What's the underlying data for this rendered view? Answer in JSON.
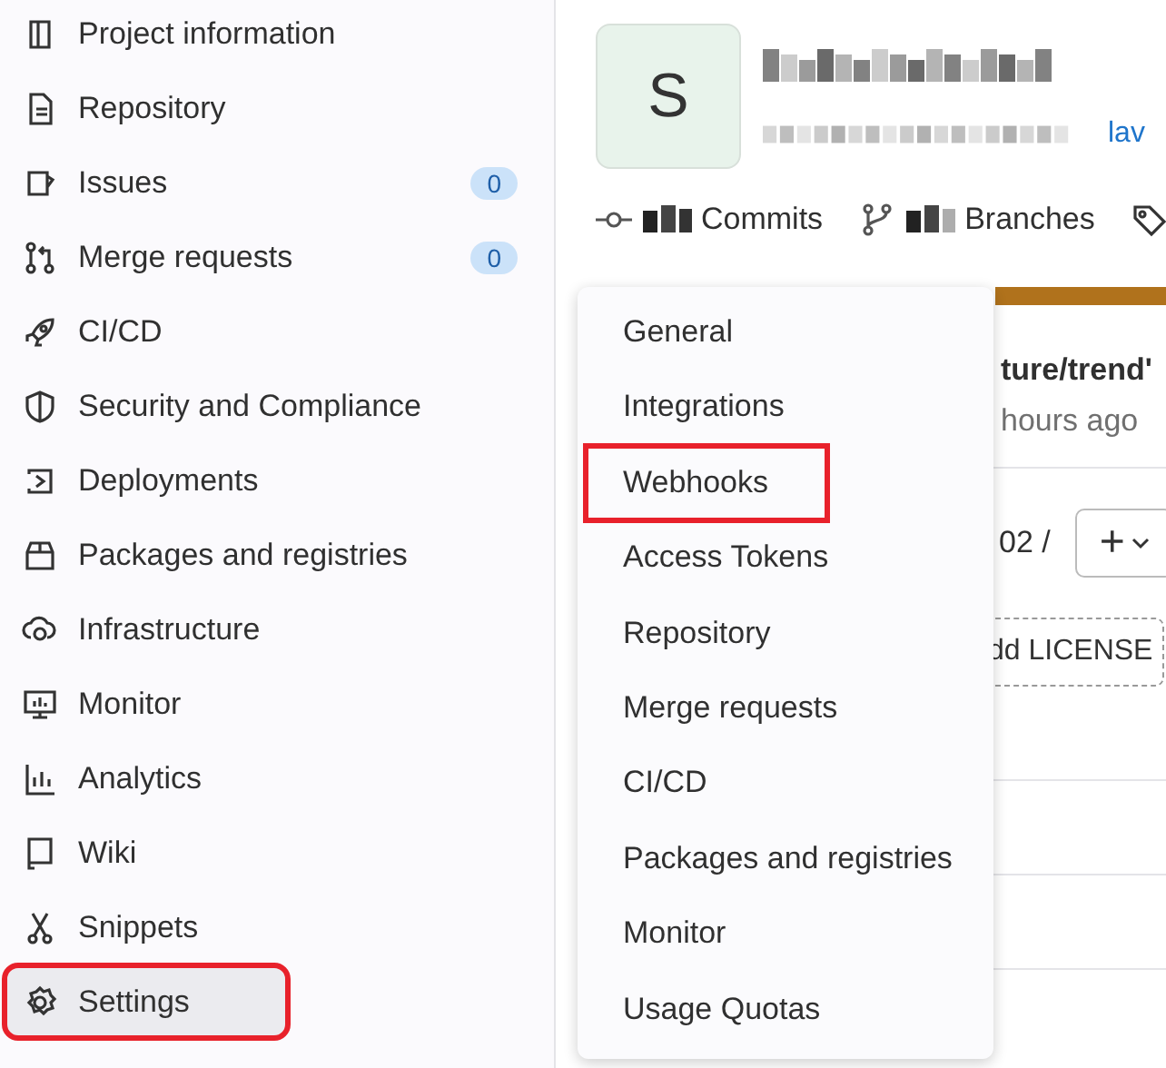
{
  "sidebar": {
    "items": [
      {
        "label": "Project information",
        "selected": false,
        "annotated": false
      },
      {
        "label": "Repository",
        "selected": false,
        "annotated": false
      },
      {
        "label": "Issues",
        "badge": "0",
        "selected": false,
        "annotated": false
      },
      {
        "label": "Merge requests",
        "badge": "0",
        "selected": false,
        "annotated": false
      },
      {
        "label": "CI/CD",
        "selected": false,
        "annotated": false
      },
      {
        "label": "Security and Compliance",
        "selected": false,
        "annotated": false
      },
      {
        "label": "Deployments",
        "selected": false,
        "annotated": false
      },
      {
        "label": "Packages and registries",
        "selected": false,
        "annotated": false
      },
      {
        "label": "Infrastructure",
        "selected": false,
        "annotated": false
      },
      {
        "label": "Monitor",
        "selected": false,
        "annotated": false
      },
      {
        "label": "Analytics",
        "selected": false,
        "annotated": false
      },
      {
        "label": "Wiki",
        "selected": false,
        "annotated": false
      },
      {
        "label": "Snippets",
        "selected": false,
        "annotated": false
      },
      {
        "label": "Settings",
        "selected": true,
        "annotated": true
      }
    ]
  },
  "project": {
    "avatar": "S",
    "link": "lav",
    "stats": [
      {
        "label": "Commits"
      },
      {
        "label": "Branches"
      }
    ]
  },
  "activity": {
    "branch": "ture/trend'",
    "time": "hours ago",
    "path": "02 /",
    "add_button": "+",
    "license_button": "dd LICENSE"
  },
  "settings_menu": {
    "items": [
      {
        "label": "General",
        "annotated": false
      },
      {
        "label": "Integrations",
        "annotated": false
      },
      {
        "label": "Webhooks",
        "annotated": true
      },
      {
        "label": "Access Tokens",
        "annotated": false
      },
      {
        "label": "Repository",
        "annotated": false
      },
      {
        "label": "Merge requests",
        "annotated": false
      },
      {
        "label": "CI/CD",
        "annotated": false
      },
      {
        "label": "Packages and registries",
        "annotated": false
      },
      {
        "label": "Monitor",
        "annotated": false
      },
      {
        "label": "Usage Quotas",
        "annotated": false
      }
    ]
  }
}
